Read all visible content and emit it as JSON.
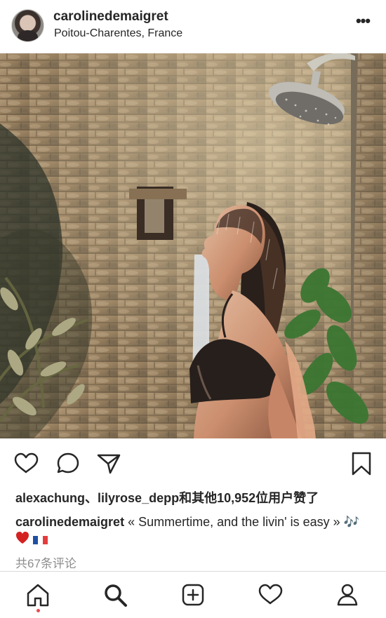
{
  "post": {
    "username": "carolinedemaigret",
    "location": "Poitou-Charentes, France",
    "more_icon": "more-horizontal-icon",
    "likes_text": "alexachung、lilyrose_depp和其他10,952位用户赞了",
    "caption_user": "carolinedemaigret",
    "caption_text": " « Summertime, and the livin' is easy » 🎶",
    "comments_text": "共67条评论"
  },
  "actions": {
    "like_icon": "heart-icon",
    "comment_icon": "comment-icon",
    "share_icon": "send-icon",
    "save_icon": "bookmark-icon"
  },
  "bottom_nav": {
    "items": [
      {
        "name": "home-icon",
        "active": true
      },
      {
        "name": "search-icon",
        "active": false
      },
      {
        "name": "new-post-icon",
        "active": false
      },
      {
        "name": "activity-heart-icon",
        "active": false
      },
      {
        "name": "profile-icon",
        "active": false
      }
    ]
  },
  "colors": {
    "text": "#262626",
    "muted": "#8e8e8e",
    "divider": "#dbdbdb",
    "heart_red": "#d42222",
    "notification_dot": "#ed4956"
  }
}
